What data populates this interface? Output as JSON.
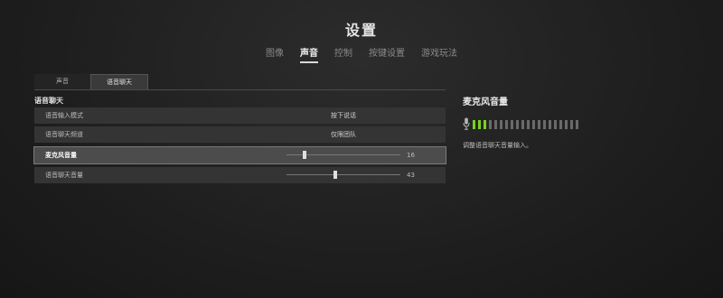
{
  "title": "设置",
  "top_tabs": [
    "图像",
    "声音",
    "控制",
    "按键设置",
    "游戏玩法"
  ],
  "active_top_tab": "声音",
  "sub_tabs": [
    "声音",
    "语音聊天"
  ],
  "active_sub_tab": "语音聊天",
  "section_title": "语音聊天",
  "rows": [
    {
      "label": "语音输入模式",
      "value": "按下说话"
    },
    {
      "label": "语音聊天频道",
      "value": "仅限团队"
    },
    {
      "label": "麦克风音量",
      "value": "16",
      "slider_fraction": 0.16
    },
    {
      "label": "语音聊天音量",
      "value": "43",
      "slider_fraction": 0.43
    }
  ],
  "selected_row": "麦克风音量",
  "right_panel": {
    "title": "麦克风音量",
    "description": "调整语音聊天音量输入。",
    "meter_total_bars": 20,
    "meter_lit_bars": 3,
    "mic_icon": "microphone-icon"
  },
  "colors": {
    "meter_on": "#78d21e",
    "meter_off": "#6a6a6a"
  }
}
